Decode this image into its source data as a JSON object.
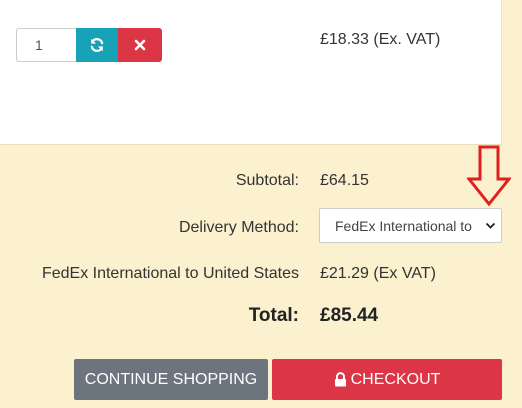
{
  "cart_item": {
    "quantity": "1",
    "price": "£18.33 (Ex. VAT)"
  },
  "summary": {
    "subtotal_label": "Subtotal:",
    "subtotal_value": "£64.15",
    "delivery_label": "Delivery Method:",
    "delivery_selected": "FedEx International to",
    "shipping_label": "FedEx International to United States",
    "shipping_value": "£21.29 (Ex VAT)",
    "total_label": "Total:",
    "total_value": "£85.44"
  },
  "actions": {
    "continue_label": "CONTINUE SHOPPING",
    "checkout_label": "CHECKOUT"
  },
  "icons": {
    "update": "refresh-icon",
    "remove": "close-icon",
    "checkout": "lock-icon",
    "select": "chevron-down-icon",
    "annotation": "arrow-down-icon"
  },
  "colors": {
    "info": "#17a2b8",
    "danger": "#dc3545",
    "secondary": "#6c757d",
    "summary_bg": "#fbf1cf",
    "annotation": "#e0201e"
  }
}
